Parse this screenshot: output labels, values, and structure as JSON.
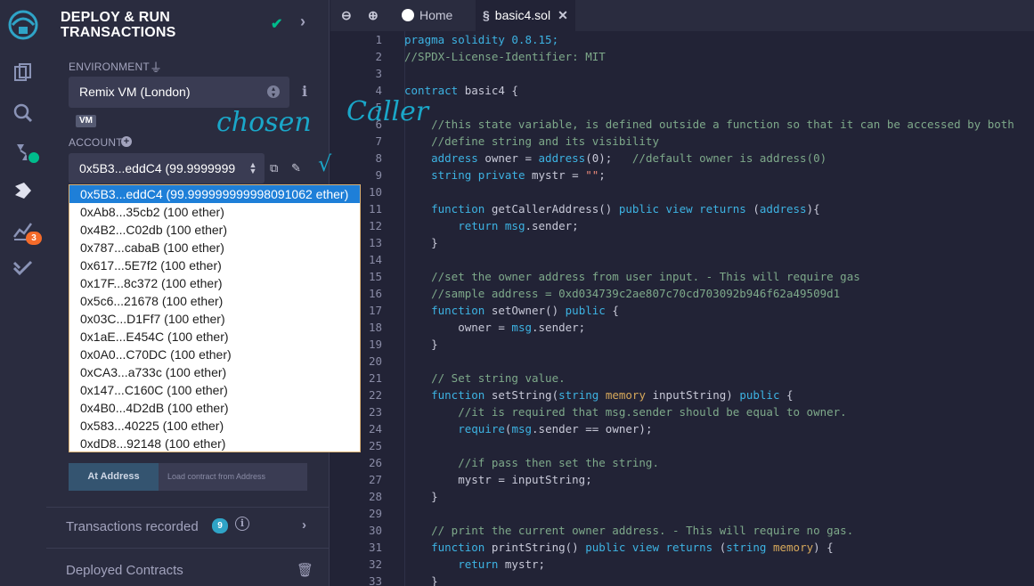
{
  "panel": {
    "title_line1": "DEPLOY & RUN",
    "title_line2": "TRANSACTIONS",
    "environment_label": "ENVIRONMENT",
    "environment_value": "Remix VM (London)",
    "vm_badge": "VM",
    "account_label": "ACCOUNT",
    "account_value": "0x5B3...eddC4 (99.9999999",
    "at_address_button": "At Address",
    "at_address_placeholder": "Load contract from Address",
    "transactions_recorded_label": "Transactions recorded",
    "transactions_recorded_count": "9",
    "deployed_contracts_label": "Deployed Contracts"
  },
  "iconbar": {
    "badge_count": "3"
  },
  "accounts": [
    "0x5B3...eddC4 (99.999999999998091062 ether)",
    "0xAb8...35cb2 (100 ether)",
    "0x4B2...C02db (100 ether)",
    "0x787...cabaB (100 ether)",
    "0x617...5E7f2 (100 ether)",
    "0x17F...8c372 (100 ether)",
    "0x5c6...21678 (100 ether)",
    "0x03C...D1Ff7 (100 ether)",
    "0x1aE...E454C (100 ether)",
    "0x0A0...C70DC (100 ether)",
    "0xCA3...a733c (100 ether)",
    "0x147...C160C (100 ether)",
    "0x4B0...4D2dB (100 ether)",
    "0x583...40225 (100 ether)",
    "0xdD8...92148 (100 ether)"
  ],
  "tabs": {
    "home": "Home",
    "file": "basic4.sol"
  },
  "annotations": {
    "chosen": "chosen",
    "caller": "Caller"
  },
  "code_lines": [
    [
      {
        "t": "pragma solidity 0.8.15;",
        "c": "kw"
      }
    ],
    [
      {
        "t": "//SPDX-License-Identifier: MIT",
        "c": "cm"
      }
    ],
    [
      {
        "t": "",
        "c": "id"
      }
    ],
    [
      {
        "t": "contract ",
        "c": "kw"
      },
      {
        "t": "basic4 {",
        "c": "id"
      }
    ],
    [
      {
        "t": "",
        "c": "id"
      }
    ],
    [
      {
        "t": "    //this state variable, is defined outside a function so that it can be accessed by both",
        "c": "cm"
      }
    ],
    [
      {
        "t": "    //define string and its visibility",
        "c": "cm"
      }
    ],
    [
      {
        "t": "    ",
        "c": "id"
      },
      {
        "t": "address",
        "c": "ty"
      },
      {
        "t": " owner = ",
        "c": "id"
      },
      {
        "t": "address",
        "c": "ty"
      },
      {
        "t": "(0);   ",
        "c": "id"
      },
      {
        "t": "//default owner is address(0)",
        "c": "cm"
      }
    ],
    [
      {
        "t": "    ",
        "c": "id"
      },
      {
        "t": "string private",
        "c": "ty"
      },
      {
        "t": " mystr = ",
        "c": "id"
      },
      {
        "t": "\"\"",
        "c": "st"
      },
      {
        "t": ";",
        "c": "id"
      }
    ],
    [
      {
        "t": "",
        "c": "id"
      }
    ],
    [
      {
        "t": "    ",
        "c": "id"
      },
      {
        "t": "function",
        "c": "kw"
      },
      {
        "t": " getCallerAddress() ",
        "c": "id"
      },
      {
        "t": "public view returns",
        "c": "kw"
      },
      {
        "t": " (",
        "c": "id"
      },
      {
        "t": "address",
        "c": "ty"
      },
      {
        "t": "){",
        "c": "id"
      }
    ],
    [
      {
        "t": "        ",
        "c": "id"
      },
      {
        "t": "return",
        "c": "kw"
      },
      {
        "t": " ",
        "c": "id"
      },
      {
        "t": "msg",
        "c": "kw"
      },
      {
        "t": ".sender;",
        "c": "id"
      }
    ],
    [
      {
        "t": "    }",
        "c": "id"
      }
    ],
    [
      {
        "t": "",
        "c": "id"
      }
    ],
    [
      {
        "t": "    //set the owner address from user input. - This will require gas",
        "c": "cm"
      }
    ],
    [
      {
        "t": "    //sample address = 0xd034739c2ae807c70cd703092b946f62a49509d1",
        "c": "cm"
      }
    ],
    [
      {
        "t": "    ",
        "c": "id"
      },
      {
        "t": "function",
        "c": "kw"
      },
      {
        "t": " setOwner() ",
        "c": "id"
      },
      {
        "t": "public",
        "c": "kw"
      },
      {
        "t": " {",
        "c": "id"
      }
    ],
    [
      {
        "t": "        owner = ",
        "c": "id"
      },
      {
        "t": "msg",
        "c": "kw"
      },
      {
        "t": ".sender;",
        "c": "id"
      }
    ],
    [
      {
        "t": "    }",
        "c": "id"
      }
    ],
    [
      {
        "t": "",
        "c": "id"
      }
    ],
    [
      {
        "t": "    // Set string value.",
        "c": "cm"
      }
    ],
    [
      {
        "t": "    ",
        "c": "id"
      },
      {
        "t": "function",
        "c": "kw"
      },
      {
        "t": " setString(",
        "c": "id"
      },
      {
        "t": "string",
        "c": "ty"
      },
      {
        "t": " ",
        "c": "id"
      },
      {
        "t": "memory",
        "c": "gold"
      },
      {
        "t": " inputString) ",
        "c": "id"
      },
      {
        "t": "public",
        "c": "kw"
      },
      {
        "t": " {",
        "c": "id"
      }
    ],
    [
      {
        "t": "        //it is required that msg.sender should be equal to owner.",
        "c": "cm"
      }
    ],
    [
      {
        "t": "        ",
        "c": "id"
      },
      {
        "t": "require",
        "c": "kw"
      },
      {
        "t": "(",
        "c": "id"
      },
      {
        "t": "msg",
        "c": "kw"
      },
      {
        "t": ".sender == owner);",
        "c": "id"
      }
    ],
    [
      {
        "t": "",
        "c": "id"
      }
    ],
    [
      {
        "t": "        //if pass then set the string.",
        "c": "cm"
      }
    ],
    [
      {
        "t": "        mystr = inputString;",
        "c": "id"
      }
    ],
    [
      {
        "t": "    }",
        "c": "id"
      }
    ],
    [
      {
        "t": "",
        "c": "id"
      }
    ],
    [
      {
        "t": "    // print the current owner address. - This will require no gas.",
        "c": "cm"
      }
    ],
    [
      {
        "t": "    ",
        "c": "id"
      },
      {
        "t": "function",
        "c": "kw"
      },
      {
        "t": " printString() ",
        "c": "id"
      },
      {
        "t": "public view returns",
        "c": "kw"
      },
      {
        "t": " (",
        "c": "id"
      },
      {
        "t": "string",
        "c": "ty"
      },
      {
        "t": " ",
        "c": "id"
      },
      {
        "t": "memory",
        "c": "gold"
      },
      {
        "t": ") {",
        "c": "id"
      }
    ],
    [
      {
        "t": "        ",
        "c": "id"
      },
      {
        "t": "return",
        "c": "kw"
      },
      {
        "t": " mystr;",
        "c": "id"
      }
    ],
    [
      {
        "t": "    }",
        "c": "id"
      }
    ]
  ]
}
